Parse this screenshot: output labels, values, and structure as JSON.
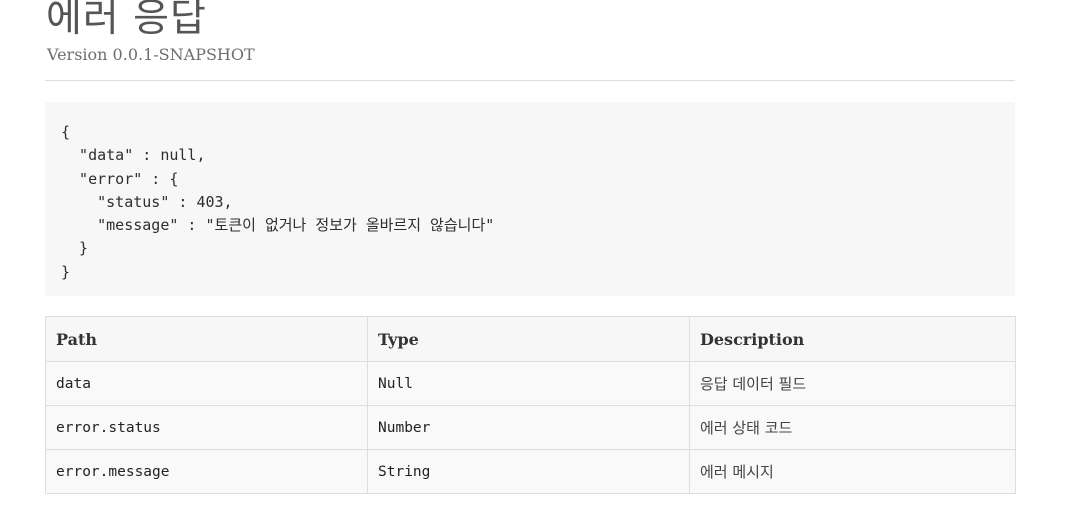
{
  "header": {
    "title": "에러 응답",
    "version": "Version 0.0.1-SNAPSHOT"
  },
  "code_block": {
    "content": "{\n  \"data\" : null,\n  \"error\" : {\n    \"status\" : 403,\n    \"message\" : \"토큰이 없거나 정보가 올바르지 않습니다\"\n  }\n}"
  },
  "fields_table": {
    "columns": [
      "Path",
      "Type",
      "Description"
    ],
    "rows": [
      {
        "path": "data",
        "type": "Null",
        "description": "응답 데이터 필드"
      },
      {
        "path": "error.status",
        "type": "Number",
        "description": "에러 상태 코드"
      },
      {
        "path": "error.message",
        "type": "String",
        "description": "에러 메시지"
      }
    ]
  }
}
